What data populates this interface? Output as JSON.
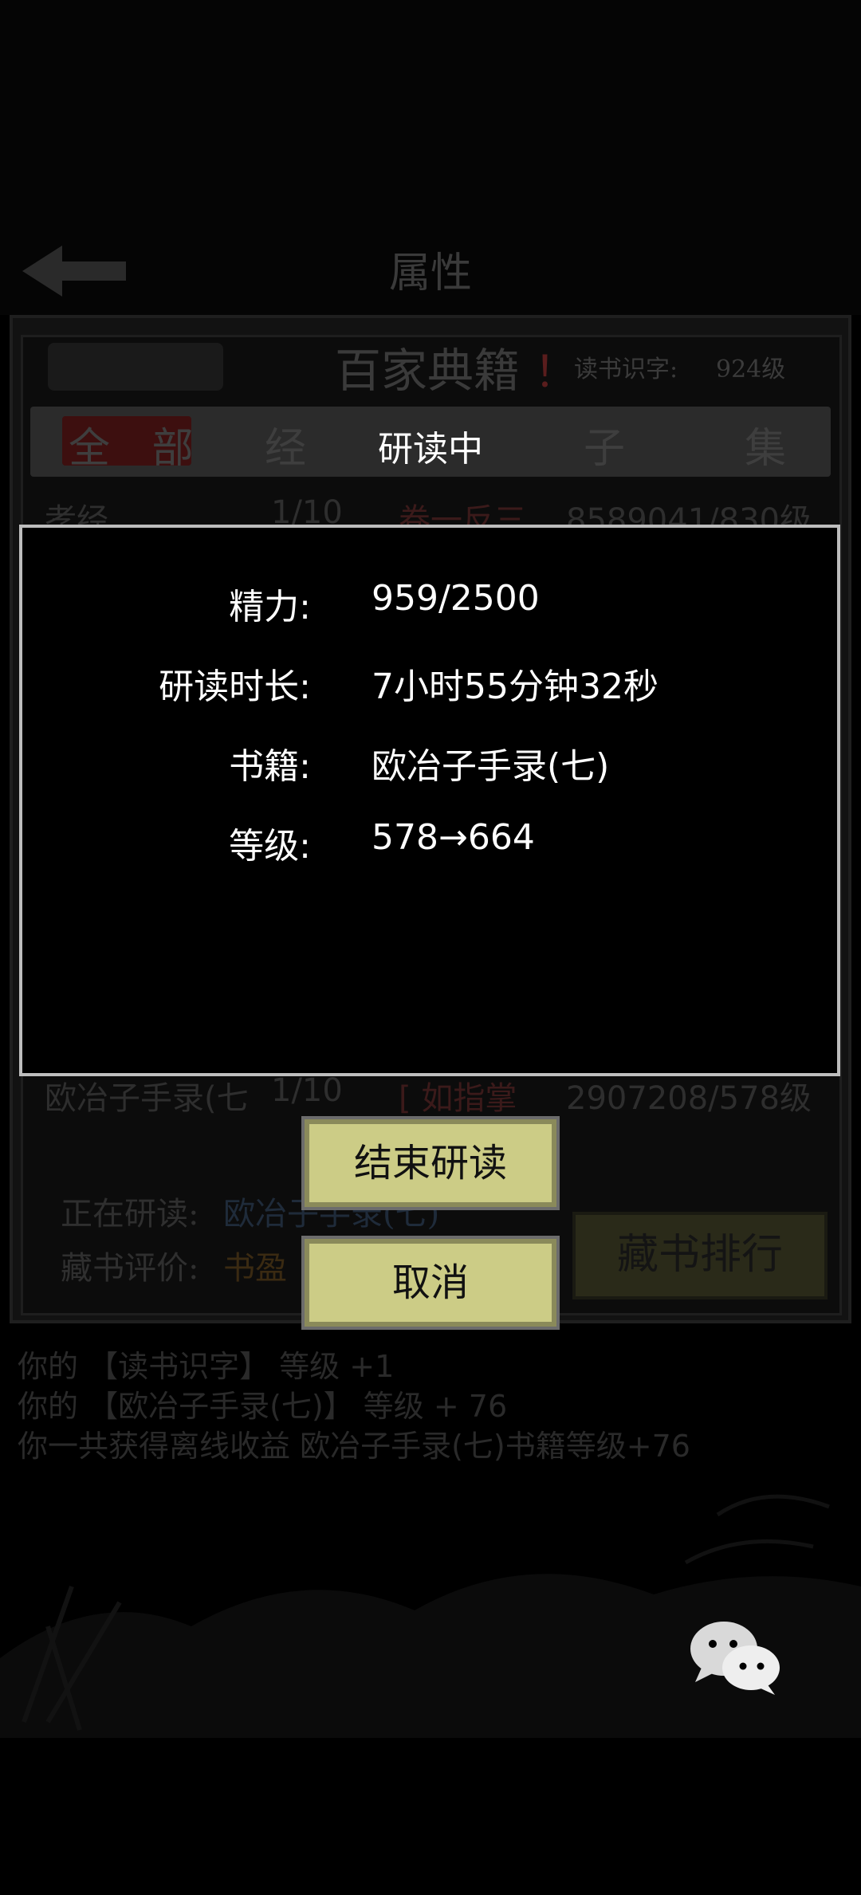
{
  "header": {
    "title": "属性"
  },
  "panel": {
    "title": "百家典籍",
    "title_mark": "！",
    "skill_label": "读书识字:",
    "skill_value": "924级"
  },
  "tabs": [
    "全 部",
    "经",
    "研读中",
    "子",
    "集"
  ],
  "rows": [
    {
      "name": "孝经",
      "progress": "1/10",
      "tag": "卷一反三",
      "stat": "8589041/830级"
    },
    {
      "name": "欧冶子手录(七",
      "progress": "1/10",
      "tag": "[ 如指掌",
      "stat": "2907208/578级"
    }
  ],
  "footer": {
    "reading_label": "正在研读:",
    "reading_value": "欧冶子手录(七)",
    "eval_label": "藏书评价:",
    "eval_value": "书盈",
    "rank_button": "藏书排行"
  },
  "log": [
    "你的 【读书识字】 等级 +1",
    "你的 【欧冶子手录(七)】 等级 + 76",
    "你一共获得离线收益 欧冶子手录(七)书籍等级+76"
  ],
  "modal": {
    "title": "研读中",
    "fields": [
      {
        "label": "精力:",
        "value": "959/2500"
      },
      {
        "label": "研读时长:",
        "value": "7小时55分钟32秒"
      },
      {
        "label": "书籍:",
        "value": "欧冶子手录(七)"
      },
      {
        "label": "等级:",
        "value": "578→664"
      }
    ],
    "end_button": "结束研读",
    "cancel_button": "取消"
  },
  "colors": {
    "button_bg": "#cccc86",
    "modal_border": "#bdbdbd"
  },
  "icons": {
    "back": "back-arrow-icon",
    "chat": "wechat-icon"
  }
}
